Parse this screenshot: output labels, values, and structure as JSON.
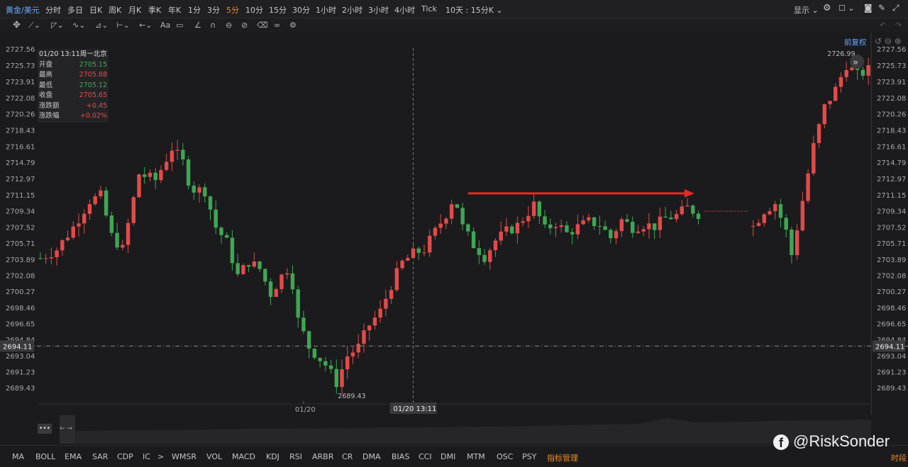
{
  "symbol": "黄金/美元",
  "timeframes": [
    "分时",
    "多日",
    "日K",
    "周K",
    "月K",
    "季K",
    "年K",
    "1分",
    "3分",
    "5分",
    "10分",
    "15分",
    "30分",
    "1小时",
    "2小时",
    "3小时",
    "4小时",
    "Tick"
  ],
  "active_timeframe": "5分",
  "range_select": "10天 : 15分K",
  "display_label": "显示",
  "adjust_label": "前复权",
  "draw_tools": {
    "text_tool": "Aa"
  },
  "ohlc": {
    "datetime": "01/20 13:11周一北京",
    "rows": [
      {
        "label": "开盘",
        "value": "2705.15",
        "dir": "dn"
      },
      {
        "label": "最高",
        "value": "2705.88",
        "dir": "up"
      },
      {
        "label": "最低",
        "value": "2705.12",
        "dir": "dn"
      },
      {
        "label": "收盘",
        "value": "2705.65",
        "dir": "up"
      },
      {
        "label": "涨跌额",
        "value": "+0.45",
        "dir": "up"
      },
      {
        "label": "涨跌幅",
        "value": "+0.02%",
        "dir": "up"
      }
    ]
  },
  "chart_data": {
    "type": "candlestick",
    "ylim": [
      2687.6,
      2729.4
    ],
    "y_ticks": [
      "2727.56",
      "2725.73",
      "2723.91",
      "2722.08",
      "2720.26",
      "2718.43",
      "2716.61",
      "2714.79",
      "2712.97",
      "2711.15",
      "2709.34",
      "2707.52",
      "2705.71",
      "2703.89",
      "2702.08",
      "2700.27",
      "2698.46",
      "2696.65",
      "2694.84",
      "2693.04",
      "2691.23",
      "2689.43"
    ],
    "x_label": "01/20",
    "crosshair_time": "01/20 13:11",
    "crosshair_price": "2694.11",
    "max_label": "2726.99",
    "min_label": "2689.43",
    "path": [
      [
        0,
        2704
      ],
      [
        3,
        2705
      ],
      [
        6,
        2707.5
      ],
      [
        9,
        2710.5
      ],
      [
        11,
        2711
      ],
      [
        13,
        2706.5
      ],
      [
        15,
        2705
      ],
      [
        18,
        2713.5
      ],
      [
        21,
        2712.8
      ],
      [
        24,
        2716.4
      ],
      [
        26,
        2714.8
      ],
      [
        27.5,
        2711.8
      ],
      [
        30,
        2711.6
      ],
      [
        32,
        2707.5
      ],
      [
        34,
        2705.8
      ],
      [
        36,
        2702
      ],
      [
        38,
        2703.6
      ],
      [
        40,
        2702.8
      ],
      [
        42,
        2700
      ],
      [
        44,
        2702
      ],
      [
        45.5,
        2703.2
      ],
      [
        47,
        2697
      ],
      [
        49,
        2694
      ],
      [
        52,
        2692
      ],
      [
        54,
        2690
      ],
      [
        56,
        2693
      ],
      [
        58,
        2694
      ],
      [
        60,
        2696.5
      ],
      [
        62,
        2698
      ],
      [
        64,
        2701
      ],
      [
        66,
        2703.5
      ],
      [
        68,
        2704.5
      ],
      [
        70,
        2705
      ],
      [
        72,
        2707
      ],
      [
        74,
        2709
      ],
      [
        75.5,
        2711.1
      ],
      [
        77,
        2707.5
      ],
      [
        79,
        2705.5
      ],
      [
        81,
        2704.2
      ],
      [
        83,
        2706
      ],
      [
        85,
        2707
      ],
      [
        87,
        2707.7
      ],
      [
        89,
        2709.2
      ],
      [
        90,
        2710
      ],
      [
        92,
        2707.2
      ],
      [
        94,
        2708
      ],
      [
        96,
        2706.8
      ],
      [
        98,
        2707.5
      ],
      [
        100,
        2708.1
      ],
      [
        102,
        2707.8
      ],
      [
        104,
        2706.3
      ],
      [
        106,
        2708.3
      ],
      [
        108,
        2707.5
      ],
      [
        110,
        2707.8
      ],
      [
        112,
        2707.6
      ],
      [
        114,
        2708.5
      ],
      [
        116,
        2708.8
      ],
      [
        118,
        2709.7
      ],
      [
        120,
        2709
      ]
    ],
    "gap_after_index": 120,
    "path2": [
      [
        130,
        2707.6
      ],
      [
        132,
        2709.4
      ],
      [
        134,
        2710.2
      ],
      [
        136,
        2707
      ],
      [
        137,
        2704.4
      ],
      [
        139,
        2710.5
      ],
      [
        141,
        2716.6
      ],
      [
        143,
        2721
      ],
      [
        145,
        2723
      ],
      [
        147,
        2725.8
      ],
      [
        149,
        2724.6
      ],
      [
        151,
        2725.2
      ]
    ],
    "arrow": {
      "from": [
        78,
        2711.3
      ],
      "to": [
        119,
        2711.3
      ]
    },
    "dotted_line": {
      "from": [
        121,
        2709.3
      ],
      "to": [
        129,
        2709.3
      ]
    }
  },
  "nav_buttons": [
    "•••",
    "←",
    "→"
  ],
  "indicators": [
    "MA",
    "BOLL",
    "EMA",
    "SAR",
    "CDP",
    "IC",
    ">",
    "WMSR",
    "VOL",
    "MACD",
    "KDJ",
    "RSI",
    "ARBR",
    "CR",
    "DMA",
    "BIAS",
    "CCI",
    "DMI",
    "MTM",
    "OSC",
    "PSY",
    "指标管理"
  ],
  "highlight_indicator": "指标管理",
  "period_label": "时段",
  "watermark": "@RiskSonder",
  "colors": {
    "up": "#e34a4a",
    "down": "#3fa653",
    "accent": "#f08a24",
    "arrow": "#e52a2a"
  }
}
